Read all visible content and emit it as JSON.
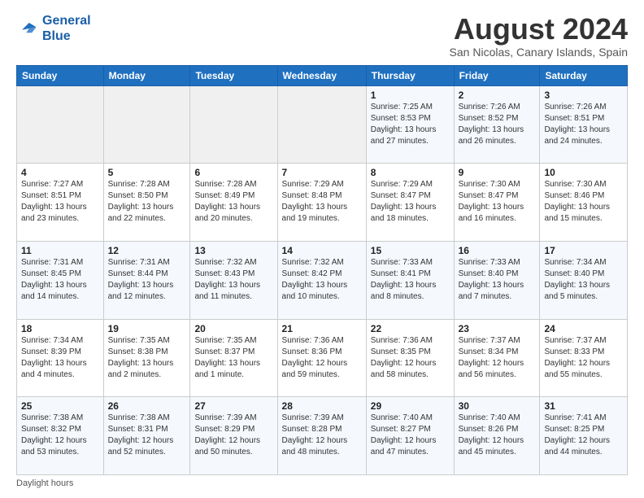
{
  "logo": {
    "line1": "General",
    "line2": "Blue"
  },
  "title": "August 2024",
  "subtitle": "San Nicolas, Canary Islands, Spain",
  "weekdays": [
    "Sunday",
    "Monday",
    "Tuesday",
    "Wednesday",
    "Thursday",
    "Friday",
    "Saturday"
  ],
  "footer": "Daylight hours",
  "weeks": [
    [
      {
        "day": "",
        "info": ""
      },
      {
        "day": "",
        "info": ""
      },
      {
        "day": "",
        "info": ""
      },
      {
        "day": "",
        "info": ""
      },
      {
        "day": "1",
        "info": "Sunrise: 7:25 AM\nSunset: 8:53 PM\nDaylight: 13 hours\nand 27 minutes."
      },
      {
        "day": "2",
        "info": "Sunrise: 7:26 AM\nSunset: 8:52 PM\nDaylight: 13 hours\nand 26 minutes."
      },
      {
        "day": "3",
        "info": "Sunrise: 7:26 AM\nSunset: 8:51 PM\nDaylight: 13 hours\nand 24 minutes."
      }
    ],
    [
      {
        "day": "4",
        "info": "Sunrise: 7:27 AM\nSunset: 8:51 PM\nDaylight: 13 hours\nand 23 minutes."
      },
      {
        "day": "5",
        "info": "Sunrise: 7:28 AM\nSunset: 8:50 PM\nDaylight: 13 hours\nand 22 minutes."
      },
      {
        "day": "6",
        "info": "Sunrise: 7:28 AM\nSunset: 8:49 PM\nDaylight: 13 hours\nand 20 minutes."
      },
      {
        "day": "7",
        "info": "Sunrise: 7:29 AM\nSunset: 8:48 PM\nDaylight: 13 hours\nand 19 minutes."
      },
      {
        "day": "8",
        "info": "Sunrise: 7:29 AM\nSunset: 8:47 PM\nDaylight: 13 hours\nand 18 minutes."
      },
      {
        "day": "9",
        "info": "Sunrise: 7:30 AM\nSunset: 8:47 PM\nDaylight: 13 hours\nand 16 minutes."
      },
      {
        "day": "10",
        "info": "Sunrise: 7:30 AM\nSunset: 8:46 PM\nDaylight: 13 hours\nand 15 minutes."
      }
    ],
    [
      {
        "day": "11",
        "info": "Sunrise: 7:31 AM\nSunset: 8:45 PM\nDaylight: 13 hours\nand 14 minutes."
      },
      {
        "day": "12",
        "info": "Sunrise: 7:31 AM\nSunset: 8:44 PM\nDaylight: 13 hours\nand 12 minutes."
      },
      {
        "day": "13",
        "info": "Sunrise: 7:32 AM\nSunset: 8:43 PM\nDaylight: 13 hours\nand 11 minutes."
      },
      {
        "day": "14",
        "info": "Sunrise: 7:32 AM\nSunset: 8:42 PM\nDaylight: 13 hours\nand 10 minutes."
      },
      {
        "day": "15",
        "info": "Sunrise: 7:33 AM\nSunset: 8:41 PM\nDaylight: 13 hours\nand 8 minutes."
      },
      {
        "day": "16",
        "info": "Sunrise: 7:33 AM\nSunset: 8:40 PM\nDaylight: 13 hours\nand 7 minutes."
      },
      {
        "day": "17",
        "info": "Sunrise: 7:34 AM\nSunset: 8:40 PM\nDaylight: 13 hours\nand 5 minutes."
      }
    ],
    [
      {
        "day": "18",
        "info": "Sunrise: 7:34 AM\nSunset: 8:39 PM\nDaylight: 13 hours\nand 4 minutes."
      },
      {
        "day": "19",
        "info": "Sunrise: 7:35 AM\nSunset: 8:38 PM\nDaylight: 13 hours\nand 2 minutes."
      },
      {
        "day": "20",
        "info": "Sunrise: 7:35 AM\nSunset: 8:37 PM\nDaylight: 13 hours\nand 1 minute."
      },
      {
        "day": "21",
        "info": "Sunrise: 7:36 AM\nSunset: 8:36 PM\nDaylight: 12 hours\nand 59 minutes."
      },
      {
        "day": "22",
        "info": "Sunrise: 7:36 AM\nSunset: 8:35 PM\nDaylight: 12 hours\nand 58 minutes."
      },
      {
        "day": "23",
        "info": "Sunrise: 7:37 AM\nSunset: 8:34 PM\nDaylight: 12 hours\nand 56 minutes."
      },
      {
        "day": "24",
        "info": "Sunrise: 7:37 AM\nSunset: 8:33 PM\nDaylight: 12 hours\nand 55 minutes."
      }
    ],
    [
      {
        "day": "25",
        "info": "Sunrise: 7:38 AM\nSunset: 8:32 PM\nDaylight: 12 hours\nand 53 minutes."
      },
      {
        "day": "26",
        "info": "Sunrise: 7:38 AM\nSunset: 8:31 PM\nDaylight: 12 hours\nand 52 minutes."
      },
      {
        "day": "27",
        "info": "Sunrise: 7:39 AM\nSunset: 8:29 PM\nDaylight: 12 hours\nand 50 minutes."
      },
      {
        "day": "28",
        "info": "Sunrise: 7:39 AM\nSunset: 8:28 PM\nDaylight: 12 hours\nand 48 minutes."
      },
      {
        "day": "29",
        "info": "Sunrise: 7:40 AM\nSunset: 8:27 PM\nDaylight: 12 hours\nand 47 minutes."
      },
      {
        "day": "30",
        "info": "Sunrise: 7:40 AM\nSunset: 8:26 PM\nDaylight: 12 hours\nand 45 minutes."
      },
      {
        "day": "31",
        "info": "Sunrise: 7:41 AM\nSunset: 8:25 PM\nDaylight: 12 hours\nand 44 minutes."
      }
    ]
  ]
}
